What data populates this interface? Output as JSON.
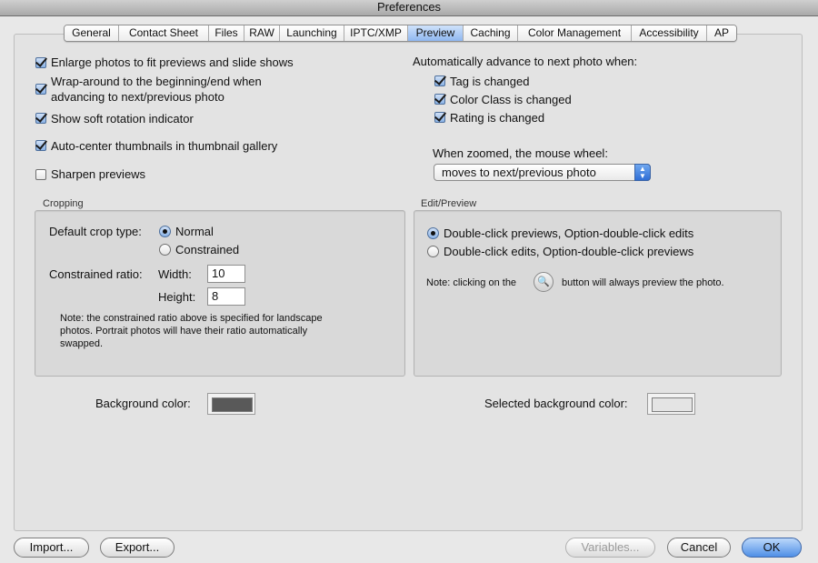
{
  "window": {
    "title": "Preferences"
  },
  "tabs": [
    {
      "label": "General"
    },
    {
      "label": "Contact Sheet"
    },
    {
      "label": "Files"
    },
    {
      "label": "RAW"
    },
    {
      "label": "Launching"
    },
    {
      "label": "IPTC/XMP"
    },
    {
      "label": "Preview",
      "active": true
    },
    {
      "label": "Caching"
    },
    {
      "label": "Color Management"
    },
    {
      "label": "Accessibility"
    },
    {
      "label": "AP"
    }
  ],
  "left_options": {
    "enlarge": {
      "label": "Enlarge photos to fit previews and slide shows",
      "checked": true
    },
    "wrap_line1": "Wrap-around to the beginning/end when",
    "wrap_line2": "advancing to next/previous photo",
    "soft_rotation": {
      "label": "Show soft rotation indicator",
      "checked": true
    },
    "autocenter": {
      "label": "Auto-center thumbnails in thumbnail gallery",
      "checked": true
    },
    "sharpen": {
      "label": "Sharpen previews",
      "checked": false
    }
  },
  "auto_advance": {
    "heading": "Automatically advance to next photo when:",
    "tag": "Tag is changed",
    "color_class": "Color Class is changed",
    "rating": "Rating is changed"
  },
  "mouse_wheel": {
    "label": "When zoomed, the mouse wheel:",
    "selected": "moves to next/previous photo"
  },
  "cropping": {
    "title": "Cropping",
    "default_crop_label": "Default crop type:",
    "normal": "Normal",
    "constrained": "Constrained",
    "ratio_label": "Constrained ratio:",
    "width_label": "Width:",
    "width_value": "10",
    "height_label": "Height:",
    "height_value": "8",
    "note_line1": "Note: the constrained ratio above is specified for landscape",
    "note_line2": "photos.  Portrait photos will have their ratio automatically",
    "note_line3": "swapped."
  },
  "edit_preview": {
    "title": "Edit/Preview",
    "option1": "Double-click previews, Option-double-click edits",
    "option2": "Double-click edits, Option-double-click previews",
    "note_prefix": "Note: clicking on the",
    "note_suffix": "button will always preview the photo."
  },
  "colors": {
    "background_label": "Background color:",
    "background_value": "#595959",
    "selected_label": "Selected background color:",
    "selected_value": "#e4e4e4"
  },
  "buttons": {
    "import": "Import...",
    "export": "Export...",
    "variables": "Variables...",
    "cancel": "Cancel",
    "ok": "OK"
  }
}
